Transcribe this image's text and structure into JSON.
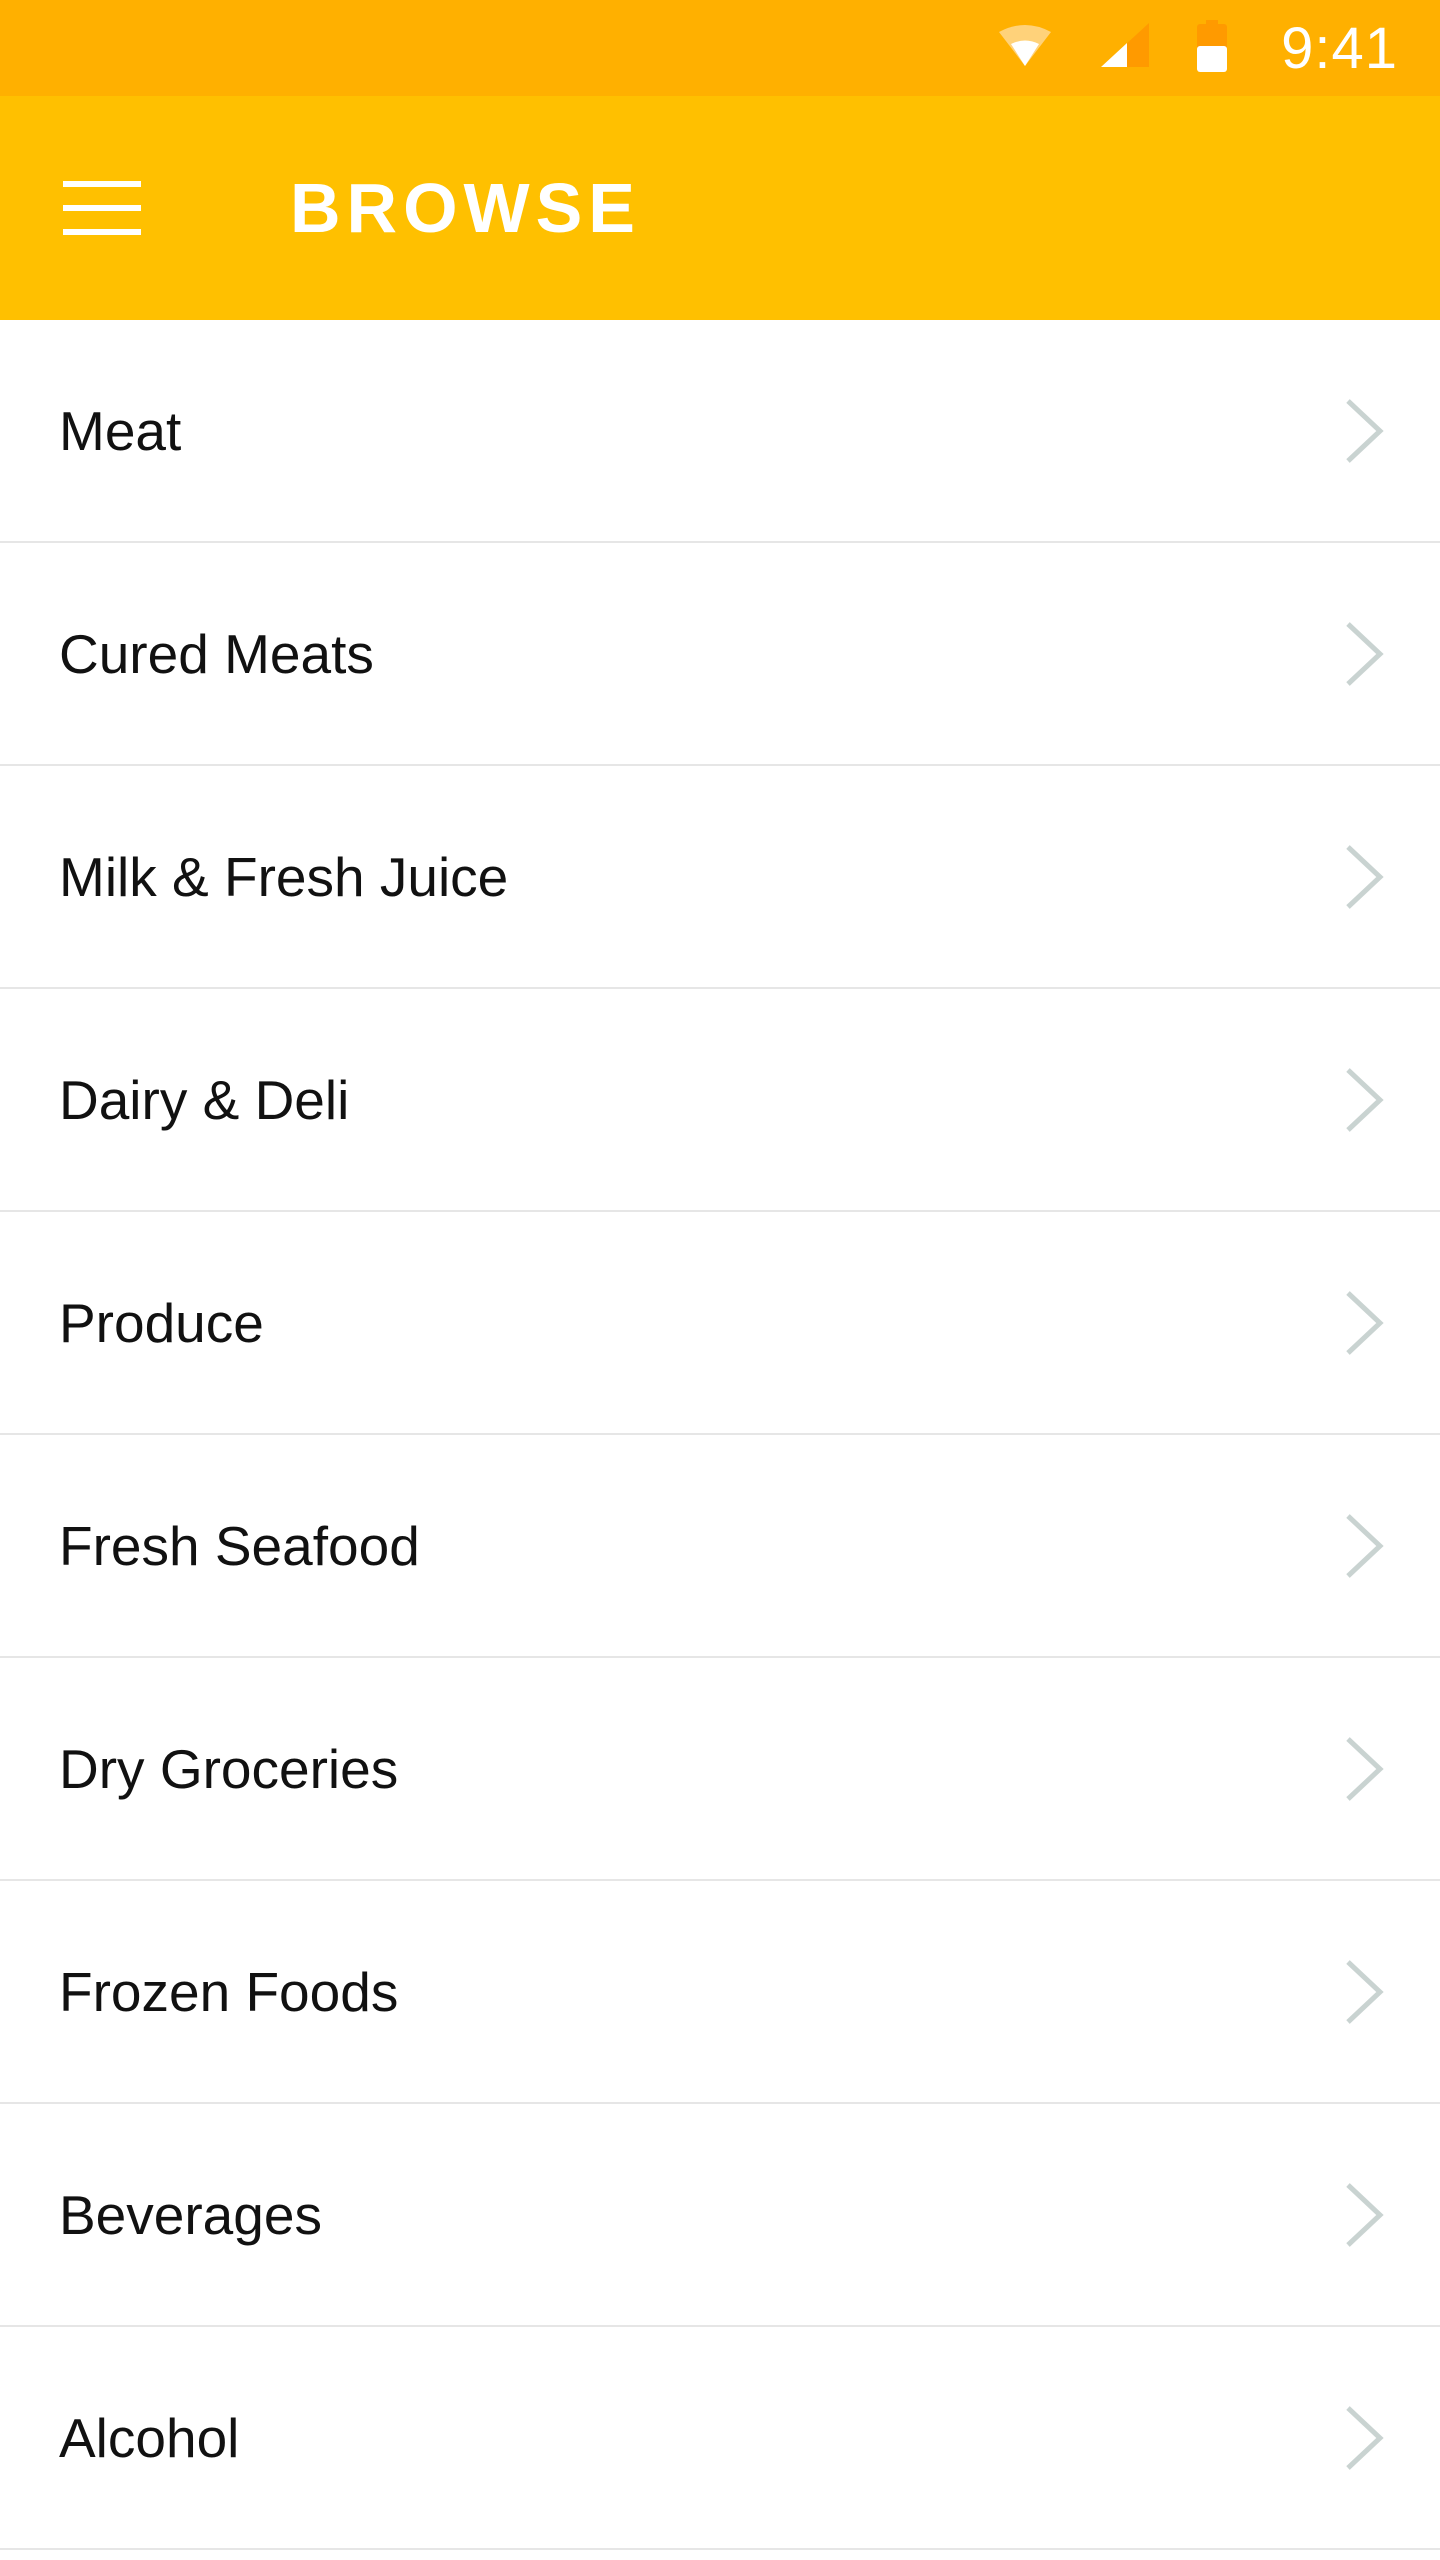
{
  "status_bar": {
    "time": "9:41",
    "background_color": "#FFB000",
    "icons": [
      "wifi-icon",
      "cellular-signal-icon",
      "battery-icon"
    ]
  },
  "app_bar": {
    "title": "BROWSE",
    "background_color": "#FFC000",
    "menu_icon": "hamburger-menu-icon"
  },
  "categories": [
    {
      "label": "Meat"
    },
    {
      "label": "Cured Meats"
    },
    {
      "label": "Milk & Fresh Juice"
    },
    {
      "label": "Dairy & Deli"
    },
    {
      "label": "Produce"
    },
    {
      "label": "Fresh Seafood"
    },
    {
      "label": "Dry Groceries"
    },
    {
      "label": "Frozen Foods"
    },
    {
      "label": "Beverages"
    },
    {
      "label": "Alcohol"
    }
  ],
  "chevron_icon": "chevron-right-icon",
  "chevron_color": "#C9D3D1",
  "divider_color": "#E6E6E6"
}
